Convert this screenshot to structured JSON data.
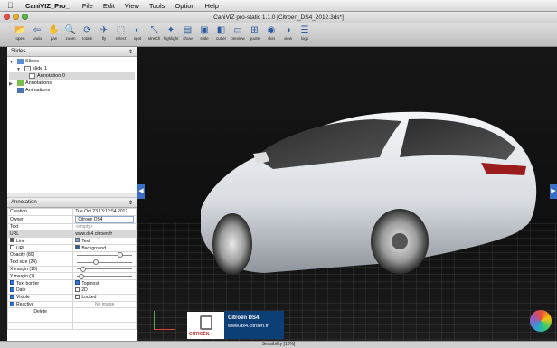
{
  "menubar": {
    "items": [
      "CaniVIZ_Pro_",
      "File",
      "Edit",
      "View",
      "Tools",
      "Option",
      "Help"
    ]
  },
  "window": {
    "title": "CaniVIZ pro-static 1.1.0 [Citroen_DS4_2012.3ds*]"
  },
  "toolbar": {
    "buttons": [
      {
        "label": "open",
        "icon": "folder-open-icon",
        "glyph": "📂"
      },
      {
        "label": "undo",
        "icon": "undo-icon",
        "glyph": "⇦"
      },
      {
        "label": "pan",
        "icon": "pan-icon",
        "glyph": "✋"
      },
      {
        "label": "zoom",
        "icon": "zoom-icon",
        "glyph": "🔍"
      },
      {
        "label": "rotate",
        "icon": "rotate-icon",
        "glyph": "⟳"
      },
      {
        "label": "fly",
        "icon": "fly-icon",
        "glyph": "✈"
      },
      {
        "label": "select",
        "icon": "select-icon",
        "glyph": "⬚"
      },
      {
        "label": "spot",
        "icon": "spot-icon",
        "glyph": "◐"
      },
      {
        "label": "stretch",
        "icon": "stretch-icon",
        "glyph": "⤡"
      },
      {
        "label": "highlight",
        "icon": "highlight-icon",
        "glyph": "✦"
      },
      {
        "label": "show",
        "icon": "show-icon",
        "glyph": "▤"
      },
      {
        "label": "slide",
        "icon": "slide-icon",
        "glyph": "▣"
      },
      {
        "label": "cutter",
        "icon": "cutter-icon",
        "glyph": "◧"
      },
      {
        "label": "preview",
        "icon": "preview-icon",
        "glyph": "▭"
      },
      {
        "label": "quote",
        "icon": "quote-icon",
        "glyph": "⊞"
      },
      {
        "label": "skin",
        "icon": "skin-icon",
        "glyph": "◉"
      },
      {
        "label": "view",
        "icon": "view-icon",
        "glyph": "◑"
      },
      {
        "label": "logs",
        "icon": "logs-icon",
        "glyph": "☰"
      }
    ]
  },
  "slides_panel": {
    "selector": "Slides",
    "tree": [
      {
        "label": "Slides",
        "level": 0
      },
      {
        "label": "slide 1",
        "level": 1
      },
      {
        "label": "Annotation 0",
        "level": 2,
        "selected": true
      },
      {
        "label": "Annotations",
        "level": 0
      },
      {
        "label": "Animations",
        "level": 0
      }
    ]
  },
  "annotation_panel": {
    "selector": "Annotation",
    "creation": {
      "label": "Creation",
      "value": "Tue Oct 23 13:12:54 2012"
    },
    "owner": {
      "label": "Owner",
      "value": "Citroen DS4"
    },
    "text": {
      "label": "Text",
      "placeholder": "<empty>"
    },
    "url": {
      "label": "URL",
      "value": "www.ds4.citroen.fr"
    },
    "line": {
      "label": "Line",
      "right_label": "Text"
    },
    "url_check": {
      "label": "URL",
      "right_label": "Background"
    },
    "opacity": {
      "label": "Opacity (80)",
      "value": 80,
      "max": 100
    },
    "text_size": {
      "label": "Text size (24)",
      "value": 24,
      "max": 72
    },
    "x_margin": {
      "label": "X margin (10)",
      "value": 10,
      "max": 100
    },
    "y_margin": {
      "label": "Y margin (7)",
      "value": 7,
      "max": 100
    },
    "text_border": {
      "label": "Text border",
      "checked": true
    },
    "topmost": {
      "label": "Topmost",
      "checked": true
    },
    "date": {
      "label": "Date",
      "checked": true
    },
    "twod": {
      "label": "2D",
      "checked": false
    },
    "visible": {
      "label": "Visible",
      "checked": true
    },
    "locked": {
      "label": "Locked",
      "checked": false
    },
    "reactive": {
      "label": "Reactive",
      "checked": true
    },
    "no_image": "No image",
    "delete_label": "Delete"
  },
  "viewport": {
    "annotation": {
      "title": "Citroën DS4",
      "url": "www.ds4.citroen.fr",
      "brand": "CITROËN"
    },
    "accent_color": "#3c6fc4"
  },
  "statusbar": {
    "text": "Sensibility [10%]"
  }
}
